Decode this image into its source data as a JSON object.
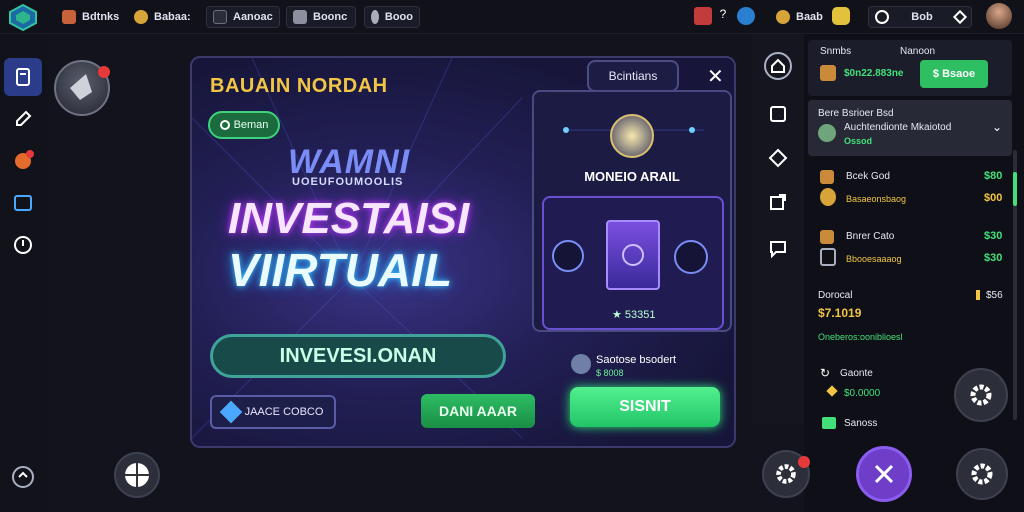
{
  "topbar": {
    "item1": "Bdtnks",
    "item2": "Babaa:",
    "item3": "Aanoac",
    "item4": "Boonc",
    "item5": "Booo",
    "coins": "Baab",
    "search_value": "Bob"
  },
  "modal": {
    "title": "BAUAIN NORDAH",
    "tab_label": "Bcintians",
    "pill_label": "Beman",
    "brand": "WAMNI",
    "brand_sub": "UOEUFOUMOOLIS",
    "hero_line1": "INVESTAISI",
    "hero_line2": "VIIRTUAIL",
    "input_value": "INVEVESI.ONAN",
    "promo_label": "JAACE COBCO",
    "daftar_label": "DANI AAAR",
    "submit_label": "SISNIT",
    "panel_title": "MONEIO ARAIL",
    "card_value": "53351",
    "submit_info": "Saotose bsodert",
    "submit_sub": "$ 8008"
  },
  "right": {
    "balance_label1": "Snmbs",
    "balance_label2": "Nanoon",
    "balance_value": "$0n22.883ne",
    "green_button": "$ Bsaoe",
    "dropdown_line1": "Bere Bsrioer Bsd",
    "dropdown_line2": "Auchtendionte Mkaiotod",
    "dropdown_line3": "Ossod",
    "item1_title": "Bcek God",
    "item1_sub": "Basaeonsbaog",
    "item1_val1": "$80",
    "item1_val2": "$00",
    "item2_title": "Bnrer Cato",
    "item2_sub": "Bbooesaaaog",
    "item2_val1": "$30",
    "item2_val2": "$30",
    "summary_label": "Dorocal",
    "summary_value": "$7.1019",
    "summary_count": "$56",
    "summary_desc": "Oneberos:ooniblioesl",
    "list1": "Gaonte",
    "list1_value": "$0.0000",
    "list2": "Sanoss"
  },
  "colors": {
    "accent_green": "#43e07a",
    "accent_yellow": "#f2c544",
    "accent_purple": "#6e3ec9",
    "active_blue": "#2a3c8a"
  }
}
